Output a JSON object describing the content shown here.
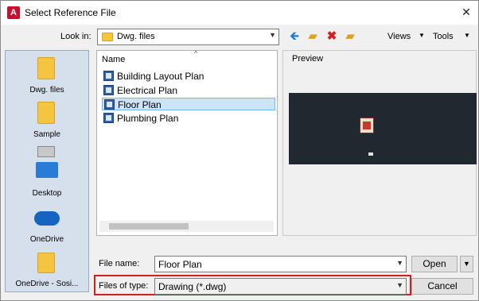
{
  "window": {
    "title": "Select Reference File"
  },
  "toolbar": {
    "look_in_label": "Look in:",
    "look_in_value": "Dwg. files",
    "views_label": "Views",
    "tools_label": "Tools"
  },
  "places": [
    {
      "label": "Dwg. files",
      "icon": "folder-icon"
    },
    {
      "label": "Sample",
      "icon": "folder-icon"
    },
    {
      "label": "Desktop",
      "icon": "desktop-icon"
    },
    {
      "label": "OneDrive",
      "icon": "cloud-icon"
    },
    {
      "label": "OneDrive - Sosi...",
      "icon": "cloud-folder-icon"
    }
  ],
  "file_list": {
    "column_name": "Name",
    "files": [
      {
        "name": "Building Layout Plan"
      },
      {
        "name": "Electrical Plan"
      },
      {
        "name": "Floor Plan",
        "selected": true
      },
      {
        "name": "Plumbing Plan"
      }
    ]
  },
  "preview": {
    "label": "Preview"
  },
  "footer": {
    "file_name_label": "File name:",
    "file_name_value": "Floor Plan",
    "files_of_type_label": "Files of type:",
    "files_of_type_value": "Drawing (*.dwg)",
    "open_label": "Open",
    "cancel_label": "Cancel"
  },
  "colors": {
    "highlight": "#d11f1f",
    "selection": "#cce4f7",
    "preview_bg": "#212830"
  }
}
